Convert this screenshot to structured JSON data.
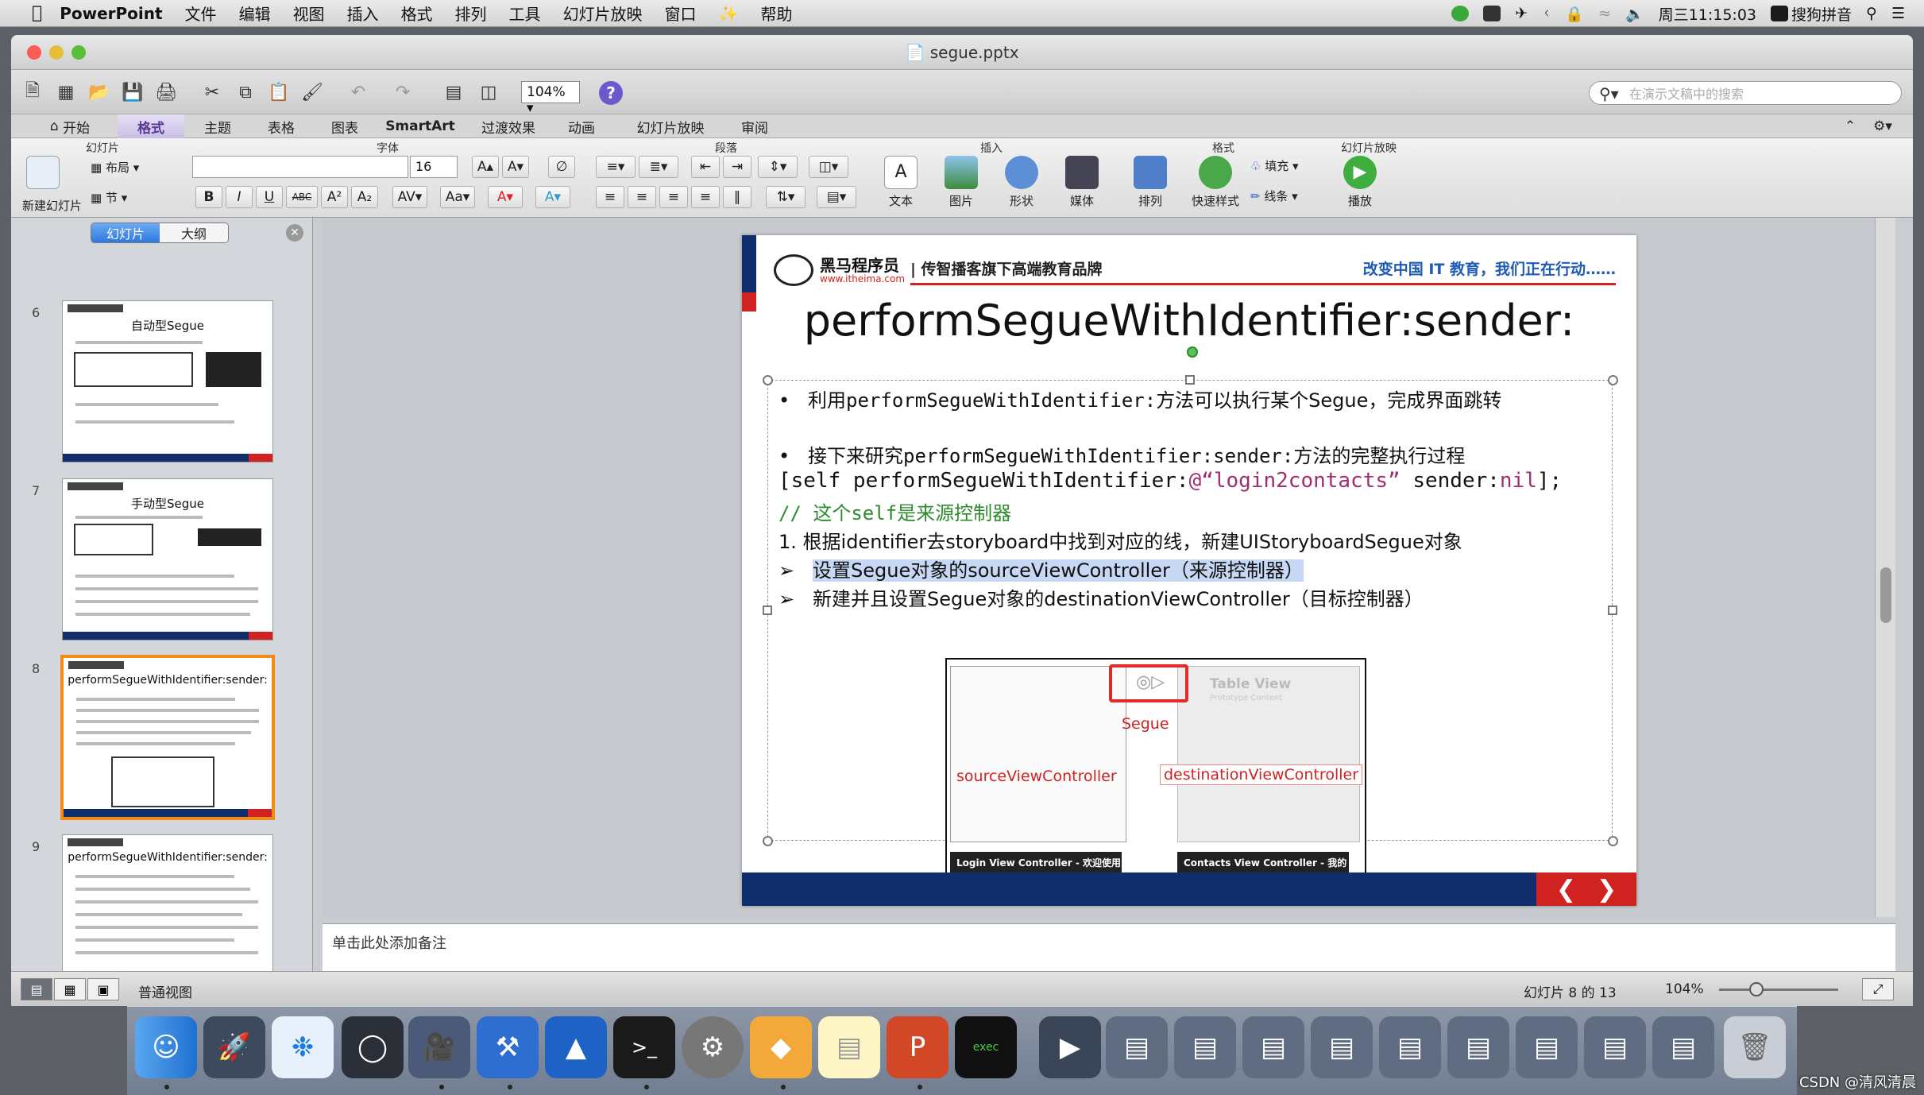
{
  "menubar": {
    "app": "PowerPoint",
    "items": [
      "文件",
      "编辑",
      "视图",
      "插入",
      "格式",
      "排列",
      "工具",
      "幻灯片放映",
      "窗口",
      "帮助"
    ],
    "clock": "周三11:15:03",
    "input_method": "搜狗拼音"
  },
  "window": {
    "title": "segue.pptx"
  },
  "toolbar": {
    "zoom": "104%",
    "search_placeholder": "在演示文稿中的搜索"
  },
  "tabs": [
    "开始",
    "格式",
    "主题",
    "表格",
    "图表",
    "SmartArt",
    "过渡效果",
    "动画",
    "幻灯片放映",
    "审阅"
  ],
  "ribbon": {
    "groups": {
      "slides": "幻灯片",
      "font": "字体",
      "paragraph": "段落",
      "insert": "插入",
      "format": "格式",
      "slideshow": "幻灯片放映"
    },
    "new_slide": "新建幻灯片",
    "layout": "布局",
    "section": "节",
    "font_size": "16",
    "insert_items": [
      "文本",
      "图片",
      "形状",
      "媒体"
    ],
    "format_items": [
      "排列",
      "快速样式"
    ],
    "fill": "填充",
    "line": "线条",
    "play": "播放"
  },
  "sidebar": {
    "tabs": [
      "幻灯片",
      "大纲"
    ],
    "thumbs": [
      {
        "num": "6",
        "title": "自动型Segue"
      },
      {
        "num": "7",
        "title": "手动型Segue"
      },
      {
        "num": "8",
        "title": "performSegueWithIdentifier:sender:"
      },
      {
        "num": "9",
        "title": "performSegueWithIdentifier:sender:"
      }
    ]
  },
  "slide": {
    "logo_text": "黑马程序员",
    "logo_url": "www.itheima.com",
    "brand": "| 传智播客旗下高端教育品牌",
    "slogan": "改变中国 IT 教育，我们正在行动……",
    "title": "performSegueWithIdentifier:sender:",
    "b1_pre": "利用",
    "b1_code": "performSegueWithIdentifier:",
    "b1_post": "方法可以执行某个Segue，完成界面跳转",
    "b2_pre": "接下来研究",
    "b2_code": "performSegueWithIdentifier:sender:",
    "b2_post": "方法的完整执行过程",
    "code_a": "[self performSegueWithIdentifier:",
    "code_b": "@“login2contacts”",
    "code_c": " sender:",
    "code_d": "nil",
    "code_e": "];",
    "comment": "// 这个self是来源控制器",
    "step1": "1. 根据identifier去storyboard中找到对应的线，新建UIStoryboardSegue对象",
    "step2": "设置Segue对象的sourceViewController（来源控制器）",
    "step3": "新建并且设置Segue对象的destinationViewController（目标控制器）",
    "bullet_arrow": "➢",
    "diagram": {
      "table_view": "Table View",
      "prototype": "Prototype Content",
      "segue": "Segue",
      "source": "sourceViewController",
      "destination": "destinationViewController",
      "login_bar": "Login View Controller - 欢迎使用",
      "contacts_bar": "Contacts View Controller - 我的"
    }
  },
  "notes": {
    "placeholder": "单击此处添加备注"
  },
  "status": {
    "view": "普通视图",
    "slide_of": "幻灯片 8 的 13",
    "zoom": "104%"
  },
  "watermark": "CSDN @清风清晨"
}
